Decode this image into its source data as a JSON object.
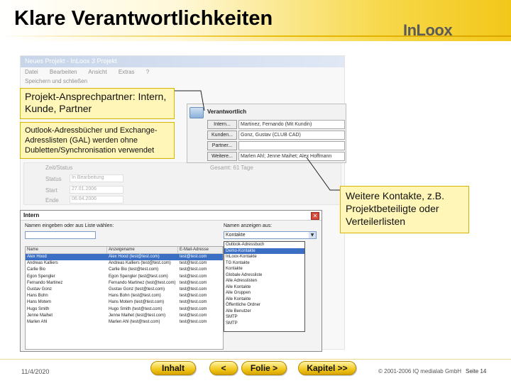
{
  "slide": {
    "title": "Klare Verantwortlichkeiten",
    "logo_main": "InLoox",
    "accent_color": "#f2c81c"
  },
  "background_window": {
    "title": "Neues Projekt - InLoox 3 Projekt",
    "menu": [
      "Datei",
      "Bearbeiten",
      "Ansicht",
      "Extras",
      "?"
    ],
    "toolbar": "Speichern und schließen",
    "section_label": "Zeit/Status",
    "rows": [
      {
        "label": "Status",
        "value": "In Bearbeitung"
      },
      {
        "label": "Start",
        "value": "27.01.2006"
      },
      {
        "label": "Ende",
        "value": "06.04.2006"
      }
    ],
    "dialog_hint": "Gesamt: 61 Tage"
  },
  "verantwortlich_panel": {
    "title": "Verantwortlich",
    "buttons": [
      "Intern...",
      "Kunden...",
      "Partner...",
      "Weitere..."
    ],
    "fields": [
      "Martinez, Fernando (Mit Kundin)",
      "Gonz, Gustav (CLUB CAD)",
      "",
      "Marlen Ahl; Jenne Maihet; Alex Hoffmann"
    ]
  },
  "callouts": {
    "c1": "Projekt-Ansprechpartner: Intern, Kunde, Partner",
    "c2": "Outlook-Adressbücher und Exchange-Adresslisten (GAL) werden ohne Dubletten/Synchronisation verwendet",
    "c3": "Weitere Kontakte, z.B. Projektbeteiligte oder Verteilerlisten"
  },
  "intern_dialog": {
    "title": "Intern",
    "search_label": "Namen eingeben oder aus Liste wählen:",
    "addressbook_label": "Namen anzeigen aus:",
    "addressbook_selected": "Kontakte",
    "columns": [
      "Name",
      "Anzeigename",
      "E-Mail-Adresse"
    ],
    "rows": [
      {
        "name": "Alex Hood",
        "display": "Alex Hood (test@test.com)",
        "email": "test@test.com",
        "selected": true
      },
      {
        "name": "Andreas Kalliers",
        "display": "Andreas Kalliers (test@test.com)",
        "email": "test@test.com",
        "selected": false
      },
      {
        "name": "Carlie Bio",
        "display": "Carlie Bio (test@test.com)",
        "email": "test@test.com",
        "selected": false
      },
      {
        "name": "Egon Spengler",
        "display": "Egon Spengler (test@test.com)",
        "email": "test@test.com",
        "selected": false
      },
      {
        "name": "Fernando Martinez",
        "display": "Fernando Martinez (test@test.com)",
        "email": "test@test.com",
        "selected": false
      },
      {
        "name": "Gustav Gonz",
        "display": "Gustav Gonz (test@test.com)",
        "email": "test@test.com",
        "selected": false
      },
      {
        "name": "Hans Bohn",
        "display": "Hans Bohn (test@test.com)",
        "email": "test@test.com",
        "selected": false
      },
      {
        "name": "Hans Motem",
        "display": "Hans Motem (test@test.com)",
        "email": "test@test.com",
        "selected": false
      },
      {
        "name": "Hugo Smith",
        "display": "Hugo Smith (test@test.com)",
        "email": "test@test.com",
        "selected": false
      },
      {
        "name": "Jenne Maihet",
        "display": "Jenne Maihet (test@test.com)",
        "email": "test@test.com",
        "selected": false
      },
      {
        "name": "Marlen Ahl",
        "display": "Marlen Ahl (test@test.com)",
        "email": "test@test.com",
        "selected": false
      }
    ],
    "dropdown_items": [
      {
        "label": "Outlook-Adressbuch",
        "selected": false
      },
      {
        "label": "Demo-Kontakte",
        "selected": true
      },
      {
        "label": "InLoox-Kontakte",
        "selected": false
      },
      {
        "label": "TG Kontakte",
        "selected": false
      },
      {
        "label": "Kontakte",
        "selected": false
      },
      {
        "label": "Globale Adressliste",
        "selected": false
      },
      {
        "label": "Alle Adresslisten",
        "selected": false
      },
      {
        "label": "Alle Kontakte",
        "selected": false
      },
      {
        "label": "Alle Gruppen",
        "selected": false
      },
      {
        "label": "Alle Kontakte",
        "selected": false
      },
      {
        "label": "Öffentliche Ordner",
        "selected": false
      },
      {
        "label": "Alle Benutzer",
        "selected": false
      },
      {
        "label": "SMTP",
        "selected": false
      },
      {
        "label": "SMTP",
        "selected": false
      }
    ]
  },
  "footer": {
    "date": "11/4/2020",
    "btn_inhalt": "Inhalt",
    "btn_back": "<",
    "btn_folie": "Folie >",
    "btn_kapitel": "Kapitel >>",
    "copyright": "© 2001-2006 IQ medialab GmbH",
    "page": "Seite 14"
  }
}
